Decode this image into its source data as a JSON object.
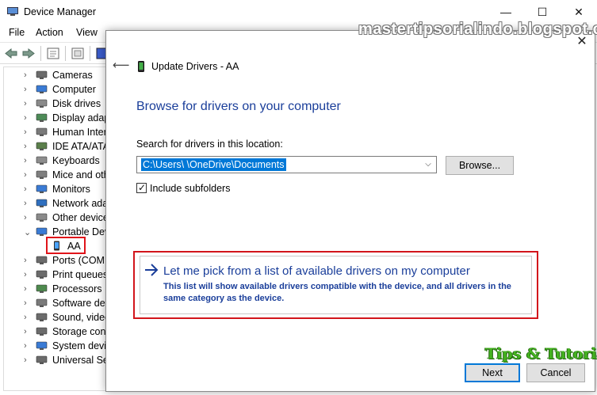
{
  "device_manager": {
    "title": "Device Manager",
    "caption": {
      "minimize": "—",
      "maximize": "☐",
      "close": "✕"
    },
    "menu": [
      "File",
      "Action",
      "View"
    ],
    "tree": [
      {
        "label": "Cameras",
        "icon": "camera-icon",
        "expanded": false
      },
      {
        "label": "Computer",
        "icon": "computer-icon",
        "expanded": false
      },
      {
        "label": "Disk drives",
        "icon": "disk-drive-icon",
        "expanded": false
      },
      {
        "label": "Display adap",
        "icon": "display-adapter-icon",
        "expanded": false
      },
      {
        "label": "Human Inter",
        "icon": "hid-icon",
        "expanded": false
      },
      {
        "label": "IDE ATA/ATAP",
        "icon": "ide-controller-icon",
        "expanded": false
      },
      {
        "label": "Keyboards",
        "icon": "keyboard-icon",
        "expanded": false
      },
      {
        "label": "Mice and oth",
        "icon": "mouse-icon",
        "expanded": false
      },
      {
        "label": "Monitors",
        "icon": "monitor-icon",
        "expanded": false
      },
      {
        "label": "Network ada",
        "icon": "network-adapter-icon",
        "expanded": false
      },
      {
        "label": "Other device",
        "icon": "other-devices-icon",
        "expanded": false
      },
      {
        "label": "Portable Dev",
        "icon": "portable-devices-icon",
        "expanded": true
      },
      {
        "label": "AA",
        "icon": "phone-icon",
        "child": true
      },
      {
        "label": "Ports (COM",
        "icon": "port-icon",
        "expanded": false
      },
      {
        "label": "Print queues",
        "icon": "printer-icon",
        "expanded": false
      },
      {
        "label": "Processors",
        "icon": "processor-icon",
        "expanded": false
      },
      {
        "label": "Software dev",
        "icon": "software-device-icon",
        "expanded": false
      },
      {
        "label": "Sound, video",
        "icon": "speaker-icon",
        "expanded": false
      },
      {
        "label": "Storage cont",
        "icon": "storage-controller-icon",
        "expanded": false
      },
      {
        "label": "System devic",
        "icon": "system-devices-icon",
        "expanded": false
      },
      {
        "label": "Universal Ser",
        "icon": "usb-icon",
        "expanded": false
      }
    ]
  },
  "update_drivers": {
    "title": "Update Drivers - AA",
    "heading": "Browse for drivers on your computer",
    "search_label": "Search for drivers in this location:",
    "path_value": "C:\\Users\\          \\OneDrive\\Documents",
    "browse_label": "Browse...",
    "include_subfolders_label": "Include subfolders",
    "include_subfolders_checked": true,
    "pick_title": "Let me pick from a list of available drivers on my computer",
    "pick_description": "This list will show available drivers compatible with the device, and all drivers in the same category as the device.",
    "next_label": "Next",
    "cancel_label": "Cancel"
  },
  "watermarks": {
    "blog": "mastertipsorialindo.blogspot.com",
    "tips": "Tips & Tutorial"
  },
  "colors": {
    "link_blue": "#1a3e9a",
    "selection_blue": "#0078d7",
    "highlight_red": "#d2151b",
    "watermark_green": "#45b320"
  }
}
